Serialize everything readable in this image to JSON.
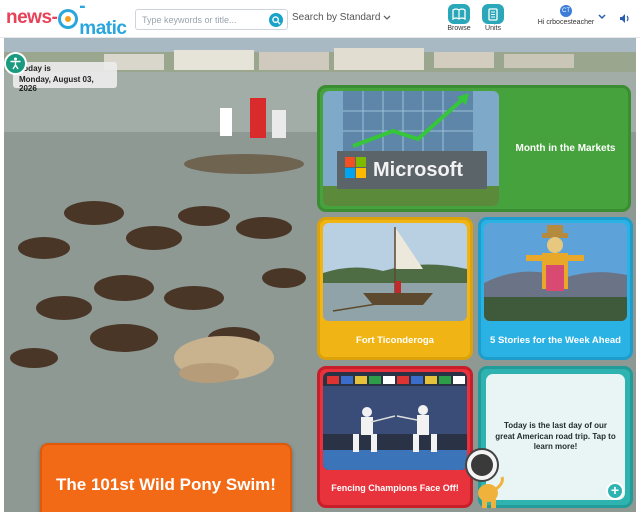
{
  "header": {
    "logo": {
      "part1": "news",
      "part2": "-",
      "part3": "-matic"
    },
    "search": {
      "placeholder": "Type keywords or title..."
    },
    "standard_label": "Search by Standard",
    "nav": [
      {
        "label": "Browse",
        "icon": "book-icon"
      },
      {
        "label": "Units",
        "icon": "document-icon"
      }
    ],
    "user": {
      "greeting": "Hi crbocesteacher",
      "initials": "CT"
    }
  },
  "hero": {
    "date_label": "Today is",
    "date_value": "Monday, August 03, 2026",
    "main_story": "The 101st Wild Pony Swim!"
  },
  "cards": {
    "markets": {
      "title": "Month in the Markets",
      "brand_text": "Microsoft"
    },
    "fort": {
      "title": "Fort Ticonderoga"
    },
    "stories": {
      "title": "5 Stories for the Week Ahead"
    },
    "fencing": {
      "title": "Fencing Champions Face Off!"
    },
    "road_trip": {
      "text": "Today is the last day of our great American road trip. Tap to learn more!"
    }
  },
  "colors": {
    "markets": "#46a23d",
    "fort": "#f0b514",
    "stories": "#2bb2e4",
    "fencing": "#e8323c",
    "road_trip": "#2fb3b0",
    "main_story": "#f26a16"
  }
}
